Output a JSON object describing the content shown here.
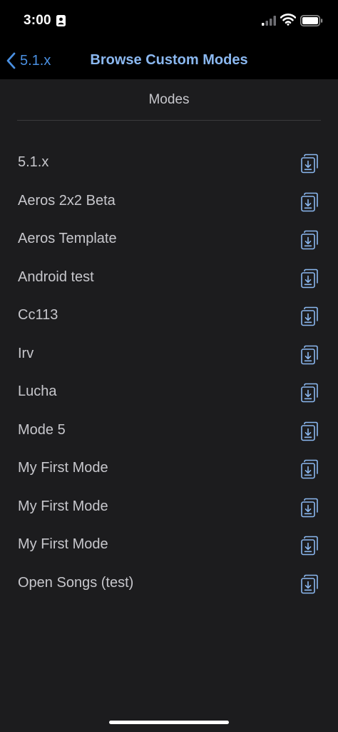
{
  "status_bar": {
    "time": "3:00"
  },
  "nav": {
    "back_label": "5.1.x",
    "title": "Browse Custom Modes"
  },
  "section": {
    "header": "Modes"
  },
  "colors": {
    "accent": "#4a90e2",
    "title": "#8bb8f0",
    "background": "#1c1c1e",
    "bar": "#000000"
  },
  "modes": [
    {
      "name": "5.1.x",
      "icon": "download-copy-icon"
    },
    {
      "name": "Aeros 2x2 Beta",
      "icon": "download-copy-icon"
    },
    {
      "name": "Aeros Template",
      "icon": "download-copy-icon"
    },
    {
      "name": "Android test",
      "icon": "download-copy-icon"
    },
    {
      "name": "Cc113",
      "icon": "download-copy-icon"
    },
    {
      "name": "Irv",
      "icon": "download-copy-icon"
    },
    {
      "name": "Lucha",
      "icon": "download-copy-icon"
    },
    {
      "name": "Mode 5",
      "icon": "download-copy-icon"
    },
    {
      "name": "My First Mode",
      "icon": "download-copy-icon"
    },
    {
      "name": "My First Mode",
      "icon": "download-copy-icon"
    },
    {
      "name": "My First Mode",
      "icon": "download-copy-icon"
    },
    {
      "name": "Open Songs (test)",
      "icon": "download-copy-icon"
    }
  ]
}
